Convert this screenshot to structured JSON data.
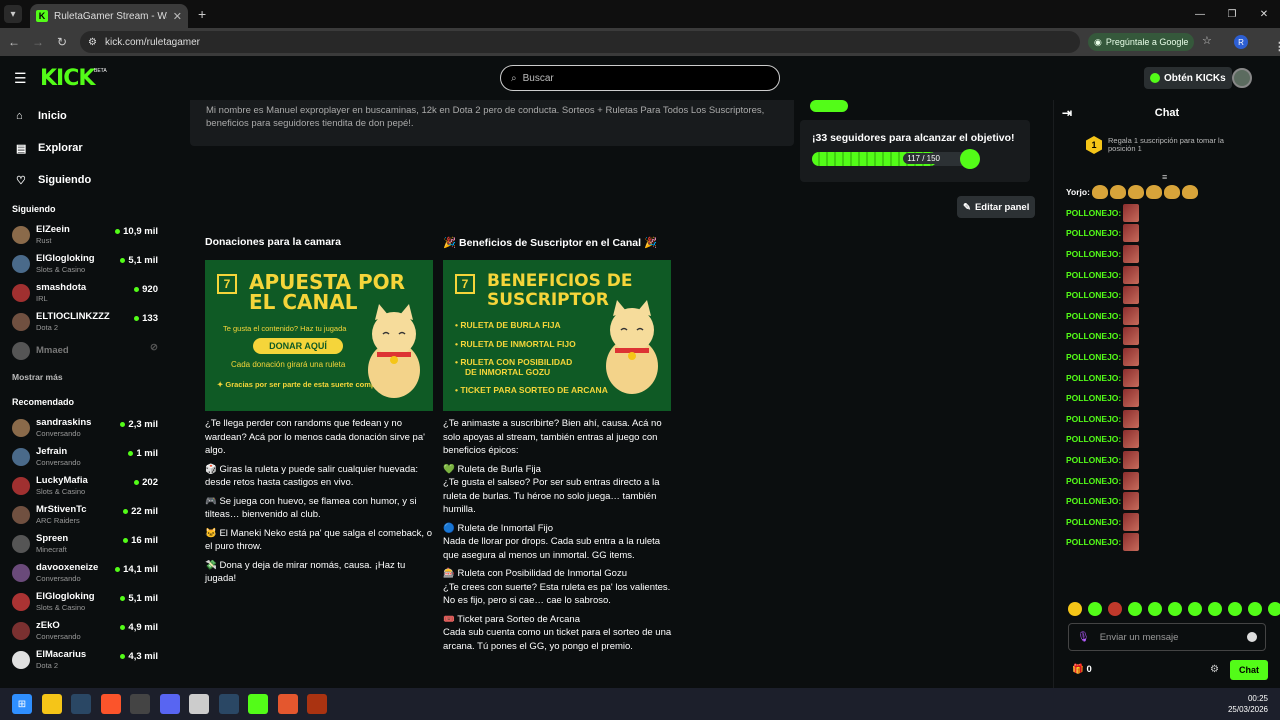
{
  "browser": {
    "tab_title": "RuletaGamer Stream - Watch L",
    "url": "kick.com/ruletagamer",
    "ask_google": "Pregúntale a Google",
    "profile_initial": "R"
  },
  "topnav": {
    "logo": "KICK",
    "beta": "BETA",
    "search_placeholder": "Buscar",
    "kicks_label": "Obtén KICKs"
  },
  "sidebar": {
    "nav": [
      {
        "label": "Inicio",
        "icon": "home-icon"
      },
      {
        "label": "Explorar",
        "icon": "compass-icon"
      },
      {
        "label": "Siguiendo",
        "icon": "heart-icon"
      }
    ],
    "following_title": "Siguiendo",
    "following": [
      {
        "name": "ElZeein",
        "category": "Rust",
        "viewers": "10,9 mil"
      },
      {
        "name": "ElGlogloking",
        "category": "Slots & Casino",
        "viewers": "5,1 mil"
      },
      {
        "name": "smashdota",
        "category": "IRL",
        "viewers": "920"
      },
      {
        "name": "ELTIOCLINKZZZ",
        "category": "Dota 2",
        "viewers": "133"
      },
      {
        "name": "Mmaed",
        "category": "",
        "viewers": ""
      }
    ],
    "show_more": "Mostrar más",
    "recommended_title": "Recomendado",
    "recommended": [
      {
        "name": "sandraskins",
        "category": "Conversando",
        "viewers": "2,3 mil"
      },
      {
        "name": "Jefrain",
        "category": "Conversando",
        "viewers": "1 mil"
      },
      {
        "name": "LuckyMafia",
        "category": "Slots & Casino",
        "viewers": "202"
      },
      {
        "name": "MrStivenTc",
        "category": "ARC Raiders",
        "viewers": "22 mil"
      },
      {
        "name": "Spreen",
        "category": "Minecraft",
        "viewers": "16 mil"
      },
      {
        "name": "davooxeneize",
        "category": "Conversando",
        "viewers": "14,1 mil"
      },
      {
        "name": "ElGlogloking",
        "category": "Slots & Casino",
        "viewers": "5,1 mil"
      },
      {
        "name": "zEkO",
        "category": "Conversando",
        "viewers": "4,9 mil"
      },
      {
        "name": "ElMacarius",
        "category": "Dota 2",
        "viewers": "4,3 mil"
      }
    ]
  },
  "about": {
    "text": "Mi nombre es Manuel exproplayer en buscaminas, 12k en Dota 2 pero de conducta. Sorteos + Ruletas Para Todos Los Suscriptores, beneficios para seguidores tiendita de don pepé!."
  },
  "goal": {
    "title": "¡33 seguidores para alcanzar el objetivo!",
    "progress_label": "117 / 150",
    "current": 117,
    "target": 150
  },
  "edit_panel": "Editar panel",
  "panels": {
    "donations": {
      "title": "Donaciones para la camara",
      "img_num": "7",
      "img_title_1": "APUESTA POR",
      "img_title_2": "EL CANAL",
      "img_sub": "Te gusta el contenido? Haz tu jugada",
      "img_button": "DONAR AQUÍ",
      "img_line": "Cada donación girará una ruleta",
      "img_thanks": "Gracias por ser parte de esta suerte compartida!",
      "paragraphs": [
        "¿Te llega perder con randoms que fedean y no wardean? Acá por lo menos cada donación sirve pa' algo.",
        "🎲 Giras la ruleta y puede salir cualquier huevada: desde retos hasta castigos en vivo.",
        "🎮 Se juega con huevo, se flamea con humor, y si tilteas… bienvenido al club.",
        "🐱 El Maneki Neko está pa' que salga el comeback, o el puro throw.",
        "💸 Dona y deja de mirar nomás, causa. ¡Haz tu jugada!"
      ]
    },
    "benefits": {
      "title": "🎉 Beneficios de Suscriptor en el Canal 🎉",
      "img_num": "7",
      "img_title_1": "BENEFICIOS DE",
      "img_title_2": "SUSCRIPTOR",
      "img_items": [
        "RULETA DE BURLA FIJA",
        "RULETA DE INMORTAL FIJO",
        "RULETA CON POSIBILIDAD",
        "DE INMORTAL GOZU",
        "TICKET PARA SORTEO DE ARCANA"
      ],
      "paragraphs": [
        "¿Te animaste a suscribirte? Bien ahí, causa. Acá no solo apoyas al stream, también entras al juego con beneficios épicos:",
        "💚 Ruleta de Burla Fija",
        "¿Te gusta el salseo? Por ser sub entras directo a la ruleta de burlas. Tu héroe no solo juega… también humilla.",
        "🔵 Ruleta de Inmortal Fijo",
        "Nada de llorar por drops. Cada sub entra a la ruleta que asegura al menos un inmortal. GG items.",
        "🎰 Ruleta con Posibilidad de Inmortal Gozu",
        "¿Te crees con suerte? Esta ruleta es pa' los valientes. No es fijo, pero si cae… cae lo sabroso.",
        "🎟️ Ticket para Sorteo de Arcana",
        "Cada sub cuenta como un ticket para el sorteo de una arcana. Tú pones el GG, yo pongo el premio."
      ]
    }
  },
  "chat": {
    "title": "Chat",
    "pin_rank": "1",
    "pin_text": "Regala 1 suscripción para tomar la posición 1",
    "first_user": "Yorjo:",
    "repeat_user": "POLLONEJO:",
    "repeat_count": 17,
    "input_placeholder": "Enviar un mensaje",
    "points": "0",
    "send_label": "Chat"
  },
  "taskbar": {
    "time": "00:25",
    "date": "25/03/2026"
  },
  "colors": {
    "kick_green": "#53fc18",
    "bg": "#0b0e0f",
    "panel_bg": "#0f5a25",
    "panel_gold": "#f5d53a"
  }
}
